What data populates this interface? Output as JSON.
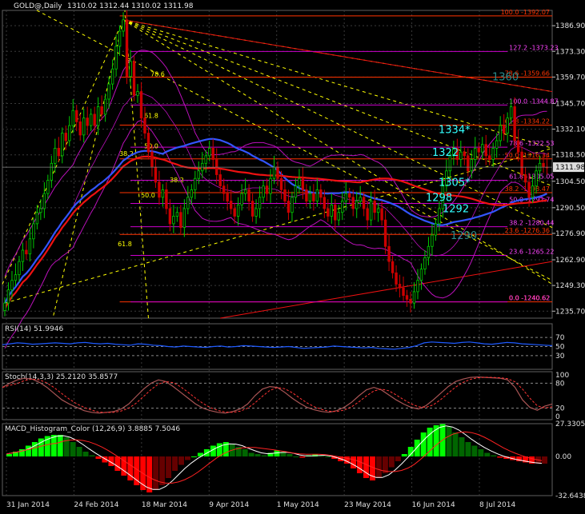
{
  "window": {
    "symbol_header": "GOLD@,Daily",
    "ohlc_header": "1310.02 1312.44 1310.02 1311.98"
  },
  "colors": {
    "background": "#000000",
    "grid": "#3a3a3a",
    "price_axis_text": "#e0e0e0",
    "bull_candle": "#00cc00",
    "bear_candle": "#cc0000",
    "fib_lines": "#ff3300",
    "fib_magenta": "#cc00cc",
    "ma_blue": "#3355ff",
    "ma_red": "#ee1111",
    "bollinger": "#bb11bb",
    "trend_yellow": "#ffff00",
    "label_cyan": "#33ffff",
    "label_teal": "#2a8a8a",
    "rsi_line": "#1e5aff",
    "stoch_main": "#aa5555",
    "macd_pos": "#00ff00",
    "macd_neg": "#ff0000"
  },
  "chart_data": [
    {
      "type": "candlestick",
      "pane": "main",
      "price_axis": [
        "1386.90",
        "1373.30",
        "1359.70",
        "1345.70",
        "1332.10",
        "1318.50",
        "1304.50",
        "1290.50",
        "1276.90",
        "1262.90",
        "1249.30",
        "1235.70"
      ],
      "ylim": [
        1232,
        1395
      ],
      "current_price": "1311.98",
      "x_labels": [
        "31 Jan 2014",
        "24 Feb 2014",
        "18 Mar 2014",
        "9 Apr 2014",
        "1 May 2014",
        "23 May 2014",
        "16 Jun 2014",
        "8 Jul 2014"
      ],
      "closes": [
        1240,
        1247,
        1252,
        1255,
        1262,
        1268,
        1266,
        1274,
        1282,
        1288,
        1290,
        1298,
        1305,
        1314,
        1322,
        1318,
        1330,
        1326,
        1334,
        1342,
        1336,
        1329,
        1338,
        1334,
        1340,
        1334,
        1344,
        1340,
        1348,
        1356,
        1364,
        1376,
        1384,
        1390,
        1360,
        1368,
        1350,
        1352,
        1338,
        1330,
        1320,
        1312,
        1304,
        1296,
        1300,
        1290,
        1282,
        1286,
        1288,
        1280,
        1290,
        1296,
        1300,
        1306,
        1310,
        1314,
        1318,
        1322,
        1316,
        1308,
        1302,
        1298,
        1294,
        1290,
        1286,
        1292,
        1298,
        1300,
        1294,
        1286,
        1290,
        1296,
        1302,
        1298,
        1306,
        1312,
        1306,
        1300,
        1294,
        1288,
        1296,
        1302,
        1306,
        1300,
        1294,
        1298,
        1294,
        1300,
        1296,
        1290,
        1286,
        1292,
        1284,
        1288,
        1294,
        1298,
        1296,
        1290,
        1294,
        1296,
        1290,
        1284,
        1294,
        1288,
        1290,
        1284,
        1270,
        1262,
        1256,
        1250,
        1248,
        1244,
        1242,
        1240,
        1246,
        1252,
        1258,
        1264,
        1270,
        1276,
        1282,
        1290,
        1302,
        1310,
        1318,
        1322,
        1316,
        1320,
        1318,
        1310,
        1316,
        1322,
        1320,
        1324,
        1318,
        1316,
        1322,
        1326,
        1334,
        1330,
        1338,
        1344,
        1326,
        1320,
        1308,
        1304,
        1296,
        1302,
        1310,
        1314,
        1312,
        1311.98
      ],
      "fib_right": [
        {
          "text": "100.0 -1392.07",
          "price": 1392.07,
          "color": "#ff3300"
        },
        {
          "text": "78.6 -1359.66",
          "price": 1359.66,
          "color": "#ff3300"
        },
        {
          "text": "61.8 -1334.22",
          "price": 1334.22,
          "color": "#ff3300"
        },
        {
          "text": "50.0 -1316.34",
          "price": 1316.34,
          "color": "#ff3300"
        },
        {
          "text": "38.2 -1298.47",
          "price": 1298.47,
          "color": "#ff3300"
        },
        {
          "text": "23.6 -1276.36",
          "price": 1276.36,
          "color": "#ff3300"
        },
        {
          "text": "0.0 -1240.62",
          "price": 1240.62,
          "color": "#ff3300"
        }
      ],
      "fib_mid": [
        {
          "text": "127.2 -1373.23",
          "price": 1373.23
        },
        {
          "text": "100.0 -1344.87",
          "price": 1344.87
        },
        {
          "text": "78.6 -1322.53",
          "price": 1322.53
        },
        {
          "text": "61.8 -1305.05",
          "price": 1305.05
        },
        {
          "text": "50.0 -1292.74",
          "price": 1292.74
        },
        {
          "text": "38.2 -1280.44",
          "price": 1280.44
        },
        {
          "text": "23.6 -1265.22",
          "price": 1265.22
        },
        {
          "text": "0.0 -1240.62",
          "price": 1240.62
        }
      ],
      "fan_labels": [
        "78.6",
        "61.8",
        "50.0",
        "38.2",
        "50.0",
        "38.2",
        "61.8"
      ],
      "target_labels": [
        {
          "text": "1360",
          "style": "teal"
        },
        {
          "text": "1334*",
          "style": "cyan"
        },
        {
          "text": "1322",
          "style": "cyan"
        },
        {
          "text": "1305*",
          "style": "cyan"
        },
        {
          "text": "1298",
          "style": "cyan"
        },
        {
          "text": "1292",
          "style": "cyan"
        },
        {
          "text": "1290",
          "style": "teal"
        }
      ]
    },
    {
      "type": "line",
      "pane": "rsi",
      "title": "RSI(14) 51.9946",
      "ylim": [
        0,
        100
      ],
      "levels": [
        "70",
        "50",
        "30"
      ],
      "values": [
        54,
        56,
        58,
        57,
        55,
        56,
        57,
        58,
        57,
        56,
        58,
        59,
        57,
        56,
        57,
        55,
        54,
        53,
        56,
        55,
        53,
        52,
        50,
        49,
        51,
        50,
        49,
        48,
        50,
        51,
        49,
        50,
        52,
        51,
        50,
        49,
        48,
        49,
        50,
        48,
        46,
        47,
        48,
        49,
        51,
        50,
        49,
        48,
        47,
        48,
        46,
        45,
        44,
        46,
        48,
        52,
        58,
        60,
        59,
        58,
        57,
        59,
        60,
        58,
        56,
        55,
        57,
        59,
        58,
        56,
        55,
        54,
        53,
        52
      ]
    },
    {
      "type": "line",
      "pane": "stochastic",
      "title": "Stoch(14,3,3) 25.2120 35.8577",
      "ylim": [
        0,
        100
      ],
      "levels": [
        "100",
        "80",
        "20",
        "0"
      ],
      "main": [
        70,
        80,
        88,
        92,
        90,
        82,
        70,
        55,
        40,
        30,
        22,
        14,
        10,
        8,
        10,
        12,
        18,
        30,
        48,
        66,
        80,
        88,
        84,
        72,
        58,
        44,
        30,
        20,
        14,
        10,
        8,
        12,
        18,
        30,
        50,
        66,
        72,
        70,
        58,
        44,
        32,
        22,
        16,
        12,
        10,
        14,
        22,
        34,
        50,
        64,
        70,
        64,
        52,
        40,
        30,
        22,
        18,
        26,
        40,
        56,
        72,
        84,
        90,
        94,
        95,
        94,
        93,
        92,
        88,
        70,
        40,
        22,
        15,
        25,
        30
      ]
    },
    {
      "type": "bar",
      "pane": "macd",
      "title": "MACD_Histogram_Color (12,26,9) 3.8885 7.5046",
      "ylim": [
        -32.6438,
        27.3305
      ],
      "axis_labels": [
        "27.3305",
        "0.00",
        "-32.6438"
      ],
      "values": [
        2,
        4,
        6,
        9,
        12,
        15,
        17,
        18,
        18,
        16,
        12,
        8,
        4,
        1,
        -2,
        -5,
        -8,
        -12,
        -16,
        -20,
        -24,
        -28,
        -30,
        -28,
        -24,
        -18,
        -12,
        -7,
        -3,
        0,
        3,
        6,
        9,
        11,
        12,
        10,
        8,
        6,
        3,
        2,
        1,
        3,
        5,
        4,
        2,
        0,
        -1,
        1,
        2,
        1,
        0,
        -2,
        -4,
        -6,
        -10,
        -14,
        -18,
        -20,
        -18,
        -14,
        -9,
        -4,
        2,
        8,
        14,
        20,
        24,
        26,
        27,
        25,
        20,
        16,
        12,
        9,
        6,
        3,
        1,
        -1,
        -2,
        -3,
        -4,
        -5,
        -6,
        -6,
        -6
      ]
    }
  ]
}
